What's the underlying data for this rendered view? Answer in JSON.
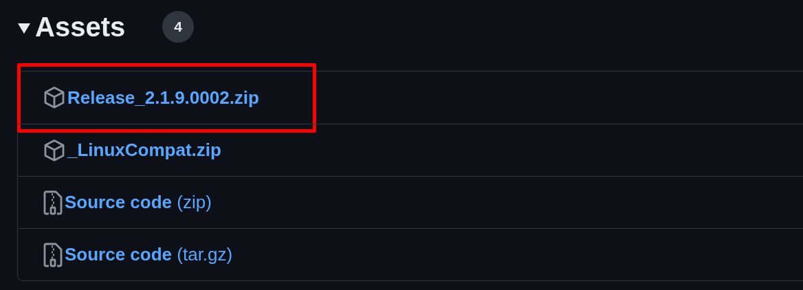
{
  "section": {
    "title": "Assets",
    "expanded": true,
    "count": "4"
  },
  "assets": [
    {
      "kind": "package",
      "name": "Release_2.1.9.0002.zip",
      "highlighted": true
    },
    {
      "kind": "package",
      "name": "_LinuxCompat.zip",
      "highlighted": false
    },
    {
      "kind": "source",
      "name": "Source code",
      "detail": "(zip)",
      "highlighted": false
    },
    {
      "kind": "source",
      "name": "Source code",
      "detail": "(tar.gz)",
      "highlighted": false
    }
  ]
}
